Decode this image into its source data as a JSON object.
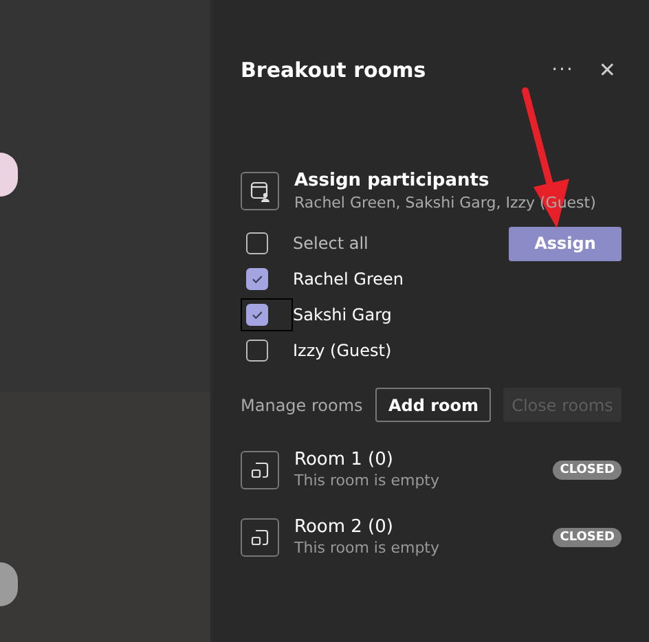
{
  "panel": {
    "title": "Breakout rooms",
    "more": "···",
    "close": "✕"
  },
  "assign": {
    "title": "Assign participants",
    "subtitle": "Rachel Green, Sakshi Garg, Izzy (Guest)",
    "select_all": {
      "label": "Select all",
      "checked": false
    },
    "button": "Assign"
  },
  "participants": [
    {
      "name": "Rachel Green",
      "checked": true,
      "focused": false
    },
    {
      "name": "Sakshi Garg",
      "checked": true,
      "focused": true
    },
    {
      "name": "Izzy (Guest)",
      "checked": false,
      "focused": false
    }
  ],
  "manage": {
    "label": "Manage rooms",
    "buttons": [
      {
        "label": "Add room",
        "disabled": false
      },
      {
        "label": "Close rooms",
        "disabled": true
      }
    ]
  },
  "rooms": [
    {
      "name": "Room 1 (0)",
      "status_text": "This room is empty",
      "badge": "CLOSED"
    },
    {
      "name": "Room 2 (0)",
      "status_text": "This room is empty",
      "badge": "CLOSED"
    }
  ]
}
